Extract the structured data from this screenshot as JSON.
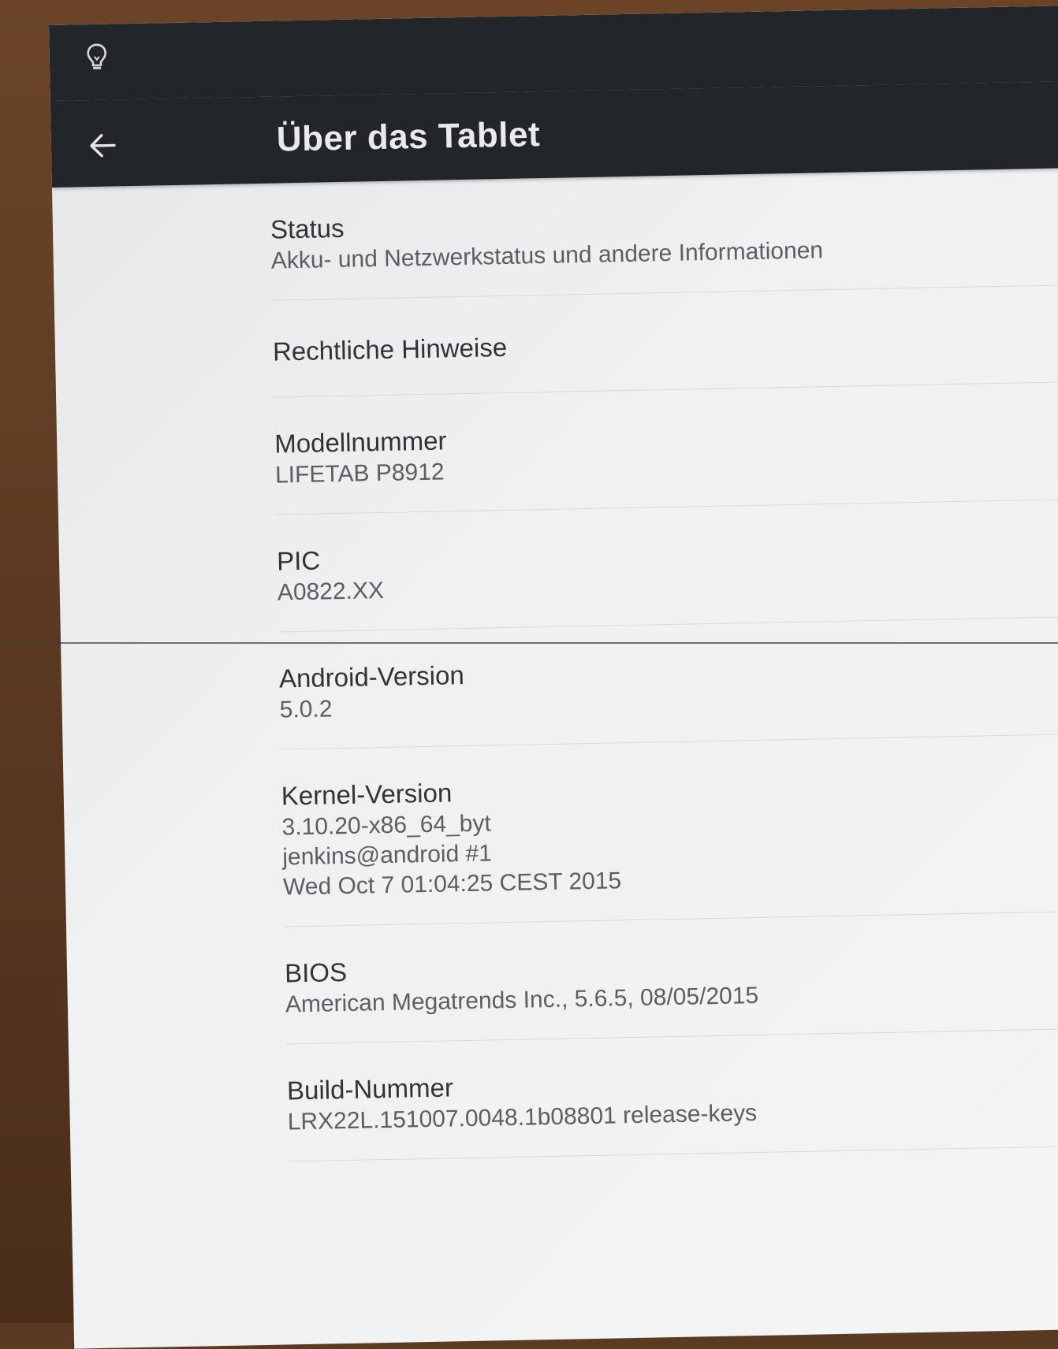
{
  "header": {
    "title": "Über das Tablet",
    "status_icon": "lightbulb-icon",
    "back_icon": "arrow-left-icon"
  },
  "items": [
    {
      "title": "Status",
      "subtitle": "Akku- und Netzwerkstatus und andere Informationen"
    },
    {
      "title": "Rechtliche Hinweise",
      "subtitle": ""
    },
    {
      "title": "Modellnummer",
      "subtitle": "LIFETAB  P8912"
    },
    {
      "title": "PIC",
      "subtitle": "A0822.XX"
    },
    {
      "title": "Android-Version",
      "subtitle": "5.0.2"
    },
    {
      "title": "Kernel-Version",
      "subtitle": "3.10.20-x86_64_byt\njenkins@android #1\nWed Oct 7 01:04:25 CEST 2015"
    },
    {
      "title": "BIOS",
      "subtitle": "American Megatrends Inc., 5.6.5, 08/05/2015"
    },
    {
      "title": "Build-Nummer",
      "subtitle": "LRX22L.151007.0048.1b08801 release-keys"
    }
  ],
  "colors": {
    "toolbar": "#222529",
    "background": "#eef0f1",
    "title_text": "#eaeaea"
  }
}
